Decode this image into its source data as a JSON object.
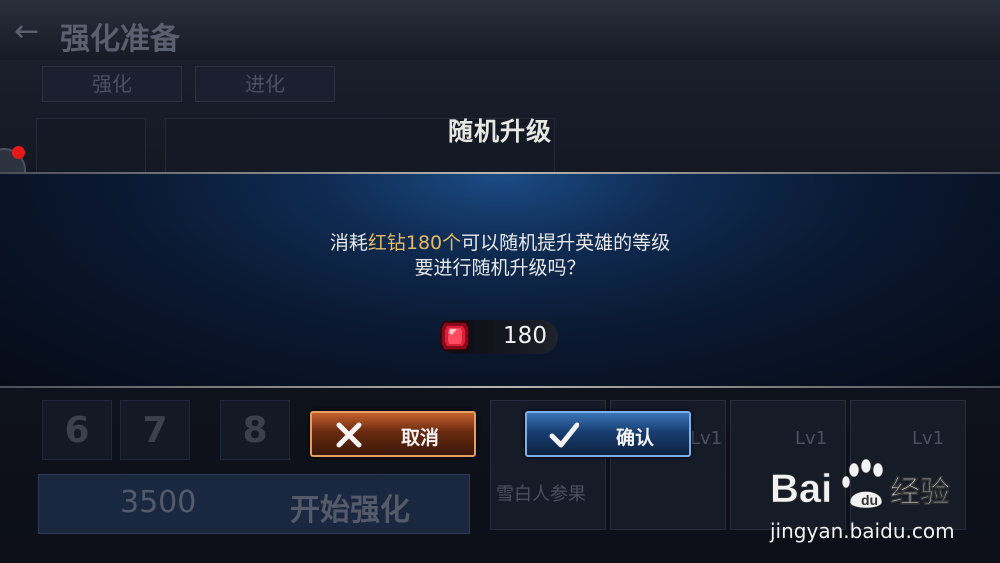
{
  "background": {
    "screen_title": "强化准备",
    "tabs": [
      "强化",
      "进化"
    ],
    "slot_numbers": [
      "6",
      "7",
      "8"
    ],
    "gold_amount": "3500",
    "start_button": "开始强化",
    "card_levels": [
      "Lv1",
      "Lv1",
      "Lv1"
    ],
    "card_name": "雪白人参果"
  },
  "dialog": {
    "title": "随机升级",
    "message_prefix": "消耗",
    "message_highlight": "红钻180个",
    "message_suffix": "可以随机提升英雄的等级",
    "message_line2": "要进行随机升级吗？",
    "cost_icon": "red-diamond-icon",
    "cost_value": "180",
    "cancel_label": "取消",
    "confirm_label": "确认"
  },
  "watermark": {
    "brand": "Baidu经验",
    "url": "jingyan.baidu.com"
  },
  "colors": {
    "highlight": "#e6b960",
    "cancel": "#c5602c",
    "confirm": "#3a74b6"
  }
}
